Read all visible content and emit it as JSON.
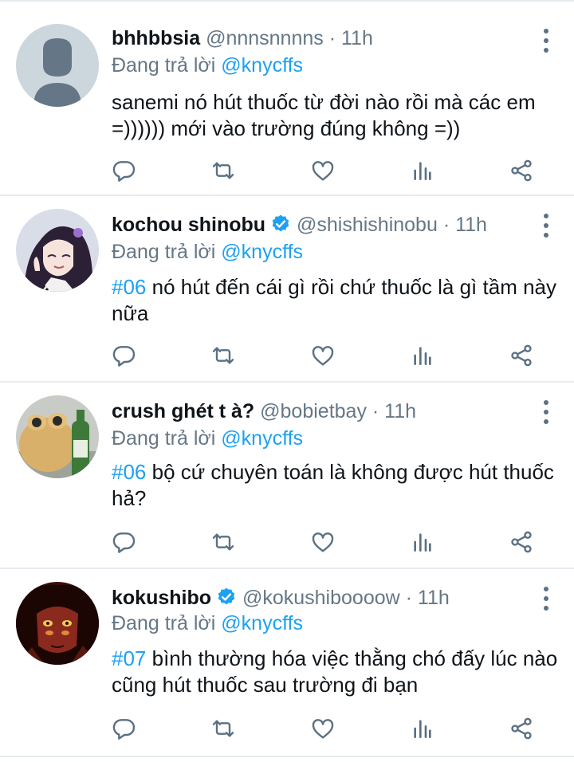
{
  "tweets": [
    {
      "name": "bhhbbsia",
      "verified": false,
      "handle": "@nnnsnnnns",
      "time": "· 11h",
      "reply_prefix": "Đang trả lời",
      "reply_to": "@knycffs",
      "hashtag": "",
      "text": "sanemi nó hút thuốc từ đời nào rồi mà các em =)))))) mới vào trường đúng không =))"
    },
    {
      "name": "kochou shinobu",
      "verified": true,
      "handle": "@shishishinobu",
      "time": "· 11h",
      "reply_prefix": "Đang trả lời",
      "reply_to": "@knycffs",
      "hashtag": "#06",
      "text": "nó hút đến cái gì rồi chứ thuốc là gì tầm này nữa"
    },
    {
      "name": "crush ghét t à?",
      "verified": false,
      "handle": "@bobietbay",
      "time": "· 11h",
      "reply_prefix": "Đang trả lời",
      "reply_to": "@knycffs",
      "hashtag": "#06",
      "text": "bộ cứ chuyên toán là không được hút thuốc hả?"
    },
    {
      "name": "kokushibo",
      "verified": true,
      "handle": "@kokushiboooow",
      "time": "· 11h",
      "reply_prefix": "Đang trả lời",
      "reply_to": "@knycffs",
      "hashtag": "#07",
      "text": "bình thường hóa việc thằng chó đấy lúc nào cũng hút thuốc sau trường đi bạn"
    }
  ],
  "icons": {
    "reply": "reply-icon",
    "retweet": "retweet-icon",
    "like": "heart-icon",
    "analytics": "analytics-icon",
    "share": "share-icon",
    "menu": "more-icon",
    "verified": "verified-badge-icon"
  },
  "colors": {
    "accent": "#1da1f2",
    "secondary_text": "#657786",
    "icon": "#5b7083",
    "divider": "#e6ecf0"
  }
}
